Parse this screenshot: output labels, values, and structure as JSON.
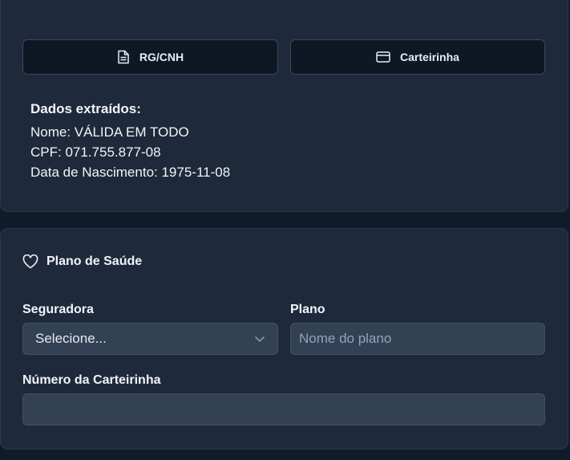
{
  "documents": {
    "rg_label": "RG/CNH",
    "carteirinha_label": "Carteirinha"
  },
  "extracted": {
    "title": "Dados extraídos:",
    "nome": "Nome: VÁLIDA EM TODO",
    "cpf": "CPF: 071.755.877-08",
    "nascimento": "Data de Nascimento: 1975-11-08"
  },
  "plano_saude": {
    "title": "Plano de Saúde",
    "seguradora_label": "Seguradora",
    "seguradora_value": "Selecione...",
    "plano_label": "Plano",
    "plano_placeholder": "Nome do plano",
    "numero_label": "Número da Carteirinha",
    "numero_value": ""
  },
  "icons": {
    "rg": "file-text-icon",
    "carteirinha": "credit-card-icon",
    "plano": "heart-icon",
    "select": "chevron-down-icon"
  },
  "colors": {
    "page_bg": "#0f1a2a",
    "card_bg": "#1e293b",
    "button_bg": "#0f1725",
    "input_bg": "#334155",
    "text": "#f1f5f9",
    "placeholder": "#94a3b8"
  }
}
